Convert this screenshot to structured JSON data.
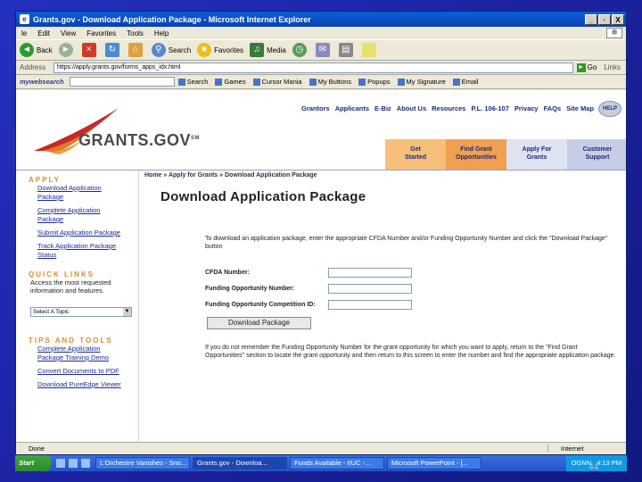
{
  "window": {
    "title": "Grants.gov - Download Application Package - Microsoft Internet Explorer",
    "buttons": [
      "_",
      "·",
      "X"
    ]
  },
  "menu": [
    "le",
    "Edit",
    "View",
    "Favorites",
    "Tools",
    "Help"
  ],
  "toolbar": {
    "back": "Back",
    "search": "Search",
    "favorites": "Favorites",
    "media": "Media"
  },
  "address": {
    "label": "Address",
    "url": "https://apply.grants.gov/forms_apps_idx.html",
    "go": "Go",
    "links": "Links"
  },
  "searchbar": {
    "brand": "mywebsearch",
    "search_btn": "Search",
    "items": [
      "Games",
      "Cursor Mania",
      "My Buttons",
      "Popups",
      "My Signature",
      "Email"
    ]
  },
  "topnav": [
    "Grantors",
    "Applicants",
    "E-Biz",
    "About Us",
    "Resources",
    "P.L. 106-107",
    "Privacy",
    "FAQs",
    "Site Map"
  ],
  "help": "HELP",
  "logo": "GRANTS.GOV",
  "logo_mark": "SM",
  "tabs": [
    {
      "label": "Get\nStarted"
    },
    {
      "label": "Find Grant\nOpportunities"
    },
    {
      "label": "Apply For\nGrants"
    },
    {
      "label": "Customer\nSupport"
    }
  ],
  "sidebar": {
    "apply_head": "APPLY",
    "apply_links": [
      "Download Application Package",
      "Complete Application Package",
      "Submit Application Package",
      "Track Application Package Status"
    ],
    "quick_head": "QUICK LINKS",
    "quick_text": "Access the most requested information and features.",
    "select": "Select A Topic",
    "tips_head": "TIPS AND TOOLS",
    "tips_links": [
      "Complete Application Package Training Demo",
      "Convert Documents to PDF",
      "Download PureEdge Viewer"
    ]
  },
  "breadcrumb": "Home » Apply for Grants » Download Application Package",
  "page_title": "Download Application Package",
  "intro": "To download an application package, enter the appropriate CFDA Number and/or Funding Opportunity Number and click the \"Download Package\" button",
  "form": {
    "cfda": "CFDA Number:",
    "fon": "Funding Opportunity Number:",
    "fcid": "Funding Opportunity Competition ID:",
    "button": "Download Package"
  },
  "note": "If you do not remember the Funding Opportunity Number for the grant opportunity for which you want to apply, return to the \"Find Grant Opportunities\" section to locate the grant opportunity and then return to this screen to enter the number and find the appropriate application package.",
  "status": {
    "left": "Done",
    "zone": "Internet"
  },
  "taskbar": {
    "start": "Start",
    "tasks": [
      "L'Orchestre Vanishes - Sno...",
      "Grants.gov - Downloa...",
      "Funds Available - IIUC -...",
      "Microsoft PowerPoint - [..."
    ],
    "tray": [
      "OGNN",
      "4:13 PM"
    ]
  },
  "page_number": "44"
}
